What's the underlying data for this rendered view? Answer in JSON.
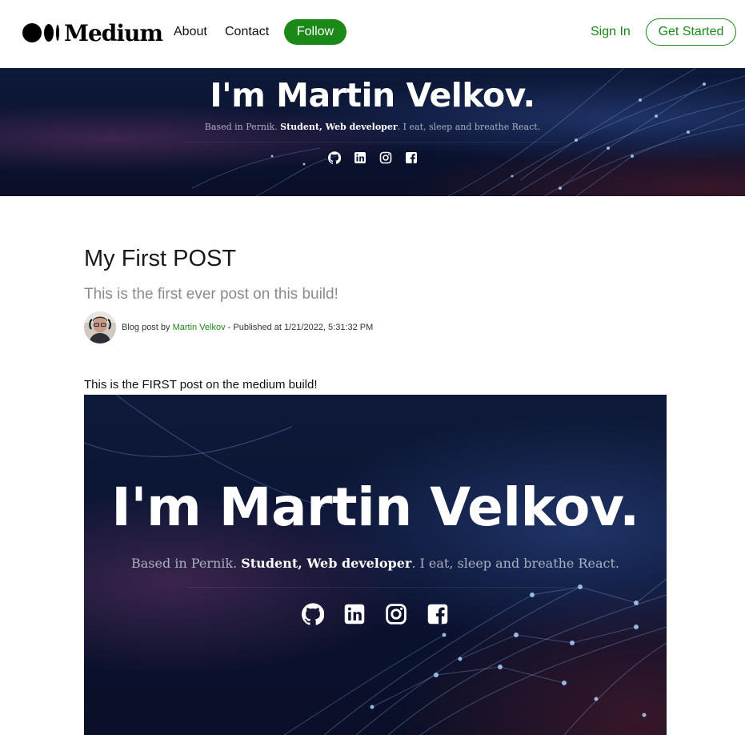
{
  "header": {
    "logo_text": "Medium",
    "nav": {
      "about": "About",
      "contact": "Contact"
    },
    "follow_label": "Follow",
    "sign_in_label": "Sign In",
    "get_started_label": "Get Started",
    "accent_color": "#1a8917"
  },
  "banner": {
    "title": "I'm Martin Velkov.",
    "subtitle_prefix": "Based in Pernik. ",
    "subtitle_bold": "Student, Web developer",
    "subtitle_suffix": ". I eat, sleep and breathe React.",
    "icons": [
      "github-icon",
      "linkedin-icon",
      "instagram-icon",
      "facebook-icon"
    ]
  },
  "post": {
    "title": "My First POST",
    "subtitle": "This is the first ever post on this build!",
    "byline_prefix": "Blog post by ",
    "author": "Martin Velkov",
    "published": " - Published at 1/21/2022, 5:31:32 PM",
    "body": "This is the FIRST post on the medium build!",
    "image": {
      "title": "I'm Martin Velkov.",
      "subtitle_prefix": "Based in Pernik. ",
      "subtitle_bold": "Student, Web developer",
      "subtitle_suffix": ". I eat, sleep and breathe React."
    }
  }
}
